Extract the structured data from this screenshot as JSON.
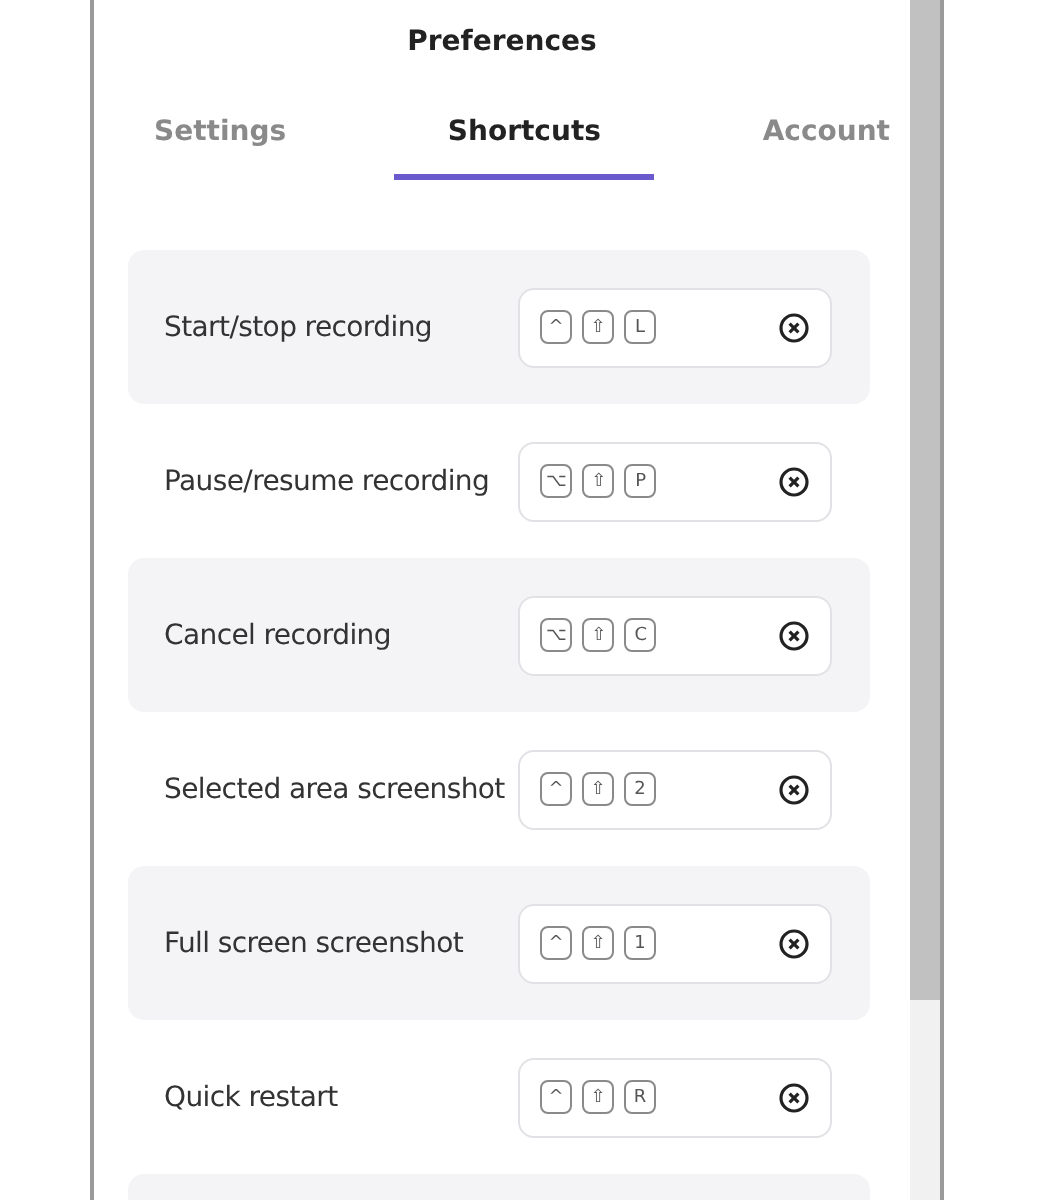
{
  "window": {
    "title": "Preferences"
  },
  "tabs": [
    {
      "label": "Settings",
      "selected": false
    },
    {
      "label": "Shortcuts",
      "selected": true
    },
    {
      "label": "Account",
      "selected": false
    }
  ],
  "shortcuts": [
    {
      "label": "Start/stop recording",
      "keys": [
        "^",
        "⇧",
        "L"
      ]
    },
    {
      "label": "Pause/resume recording",
      "keys": [
        "⌥",
        "⇧",
        "P"
      ]
    },
    {
      "label": "Cancel recording",
      "keys": [
        "⌥",
        "⇧",
        "C"
      ]
    },
    {
      "label": "Selected area screenshot",
      "keys": [
        "^",
        "⇧",
        "2"
      ]
    },
    {
      "label": "Full screen screenshot",
      "keys": [
        "^",
        "⇧",
        "1"
      ]
    },
    {
      "label": "Quick restart",
      "keys": [
        "^",
        "⇧",
        "R"
      ]
    }
  ]
}
